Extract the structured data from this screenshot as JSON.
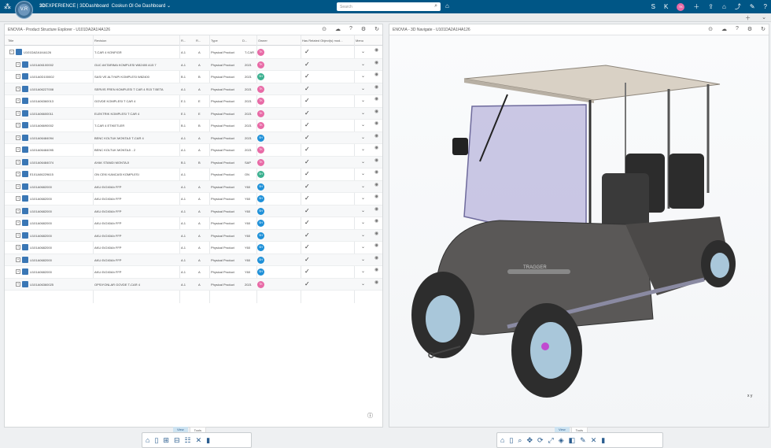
{
  "topbar": {
    "brand_prefix": "3D",
    "brand": "EXPERIENCE | 3DDashboard",
    "dashboard_name": "Coskun Ol Ge Dashboard",
    "search_placeholder": "Search",
    "compass_label": "V.R",
    "user_initials": "TK",
    "user_letters": [
      "S",
      "K"
    ]
  },
  "left_panel": {
    "title": "ENOVIA - Product Structure Explorer - U101DA2A1I4A126",
    "columns": [
      "Title",
      "Revision",
      "R...",
      "R...",
      "Type",
      "D...",
      "Owner",
      "Has Related Object(s) mod...",
      "Menu"
    ],
    "rows": [
      {
        "title": "U101DA2A1I4A126",
        "revision": "T-CAR 4 KONFIGR",
        "r1": "A.1",
        "r2": "A",
        "type": "Physical Product",
        "d": "T-CAR",
        "owner": "TK",
        "owner_color": "#e86aa6",
        "level": 0
      },
      {
        "title": "U101A06100002",
        "revision": "GUC AKTARIMA KOMPLESI W82400 A15 7",
        "r1": "A.1",
        "r2": "A",
        "type": "Physical Product",
        "d": "2021",
        "owner": "TK",
        "owner_color": "#e86aa6",
        "level": 1
      },
      {
        "title": "U101A0D100002",
        "revision": "SASI VE ALTYAPI KOMPLESI W82400",
        "r1": "B.1",
        "r2": "B",
        "type": "Physical Product",
        "d": "2021",
        "owner": "SH",
        "owner_color": "#3bb08f",
        "level": 1
      },
      {
        "title": "U101A06227008",
        "revision": "SERVIS FREN KOMPLESI T CAR 4 R15 T BETA",
        "r1": "A.1",
        "r2": "A",
        "type": "Physical Product",
        "d": "2021",
        "owner": "TK",
        "owner_color": "#e86aa6",
        "level": 1
      },
      {
        "title": "U101A06360013",
        "revision": "GOVDE KOMPLESI T CAR 4",
        "r1": "E.1",
        "r2": "E",
        "type": "Physical Product",
        "d": "2021",
        "owner": "TK",
        "owner_color": "#e86aa6",
        "level": 1
      },
      {
        "title": "U101A06600011",
        "revision": "ELEKTRIK KOMPLESI T CAR 4",
        "r1": "E.1",
        "r2": "E",
        "type": "Physical Product",
        "d": "2021",
        "owner": "TK",
        "owner_color": "#e86aa6",
        "level": 1
      },
      {
        "title": "U101A06690002",
        "revision": "T-CAR 4 ETIKETLER",
        "r1": "B.1",
        "r2": "B",
        "type": "Physical Product",
        "d": "2021",
        "owner": "TK",
        "owner_color": "#e86aa6",
        "level": 1
      },
      {
        "title": "U101A06484094",
        "revision": "BENC KOLTUK MONTAJI T-CAR 4",
        "r1": "A.1",
        "r2": "A",
        "type": "Physical Product",
        "d": "2021",
        "owner": "SH",
        "owner_color": "#1e90d8",
        "level": 1
      },
      {
        "title": "U101A06484095",
        "revision": "BENC KOLTUK MONTAJI - 2",
        "r1": "A.1",
        "r2": "A",
        "type": "Physical Product",
        "d": "2021",
        "owner": "TK",
        "owner_color": "#e86aa6",
        "level": 1
      },
      {
        "title": "U101A06484074",
        "revision": "AYAK STANDI MONTAJI",
        "r1": "B.1",
        "r2": "B",
        "type": "Physical Product",
        "d": "SAP",
        "owner": "TK",
        "owner_color": "#e86aa6",
        "level": 1
      },
      {
        "title": "E101A06229615",
        "revision": "ON CEKI KANCASI KOMPLESI",
        "r1": "A.1",
        "r2": "",
        "type": "Physical Product",
        "d": "ON",
        "owner": "SH",
        "owner_color": "#3bb08f",
        "level": 1
      },
      {
        "title": "U101A0682000",
        "revision": "AKU 6V240Ah FFP",
        "r1": "A.1",
        "r2": "A",
        "type": "Physical Product",
        "d": "Y60",
        "owner": "SH",
        "owner_color": "#1e90d8",
        "level": 1
      },
      {
        "title": "U101A0682000",
        "revision": "AKU 6V240Ah FFP",
        "r1": "A.1",
        "r2": "A",
        "type": "Physical Product",
        "d": "Y60",
        "owner": "SH",
        "owner_color": "#1e90d8",
        "level": 1
      },
      {
        "title": "U101A0682000",
        "revision": "AKU 6V240Ah FFP",
        "r1": "A.1",
        "r2": "A",
        "type": "Physical Product",
        "d": "Y60",
        "owner": "SH",
        "owner_color": "#1e90d8",
        "level": 1
      },
      {
        "title": "U101A0682000",
        "revision": "AKU 6V240Ah FFP",
        "r1": "A.1",
        "r2": "A",
        "type": "Physical Product",
        "d": "Y60",
        "owner": "SH",
        "owner_color": "#1e90d8",
        "level": 1
      },
      {
        "title": "U101A0682000",
        "revision": "AKU 6V240Ah FFP",
        "r1": "A.1",
        "r2": "A",
        "type": "Physical Product",
        "d": "Y60",
        "owner": "SH",
        "owner_color": "#1e90d8",
        "level": 1
      },
      {
        "title": "U101A0682000",
        "revision": "AKU 6V240Ah FFP",
        "r1": "A.1",
        "r2": "A",
        "type": "Physical Product",
        "d": "Y60",
        "owner": "SH",
        "owner_color": "#1e90d8",
        "level": 1
      },
      {
        "title": "U101A0682000",
        "revision": "AKU 6V240Ah FFP",
        "r1": "A.1",
        "r2": "A",
        "type": "Physical Product",
        "d": "Y60",
        "owner": "SH",
        "owner_color": "#1e90d8",
        "level": 1
      },
      {
        "title": "U101A0682000",
        "revision": "AKU 6V240Ah FFP",
        "r1": "A.1",
        "r2": "A",
        "type": "Physical Product",
        "d": "Y60",
        "owner": "SH",
        "owner_color": "#1e90d8",
        "level": 1
      },
      {
        "title": "U101A06360025",
        "revision": "OPSIYONLAR GOVDE T-CAR 4",
        "r1": "A.1",
        "r2": "A",
        "type": "Physical Product",
        "d": "2021",
        "owner": "TK",
        "owner_color": "#e86aa6",
        "level": 1
      }
    ],
    "view_tab": "View",
    "tools_tab": "Tools"
  },
  "right_panel": {
    "title": "ENOVIA - 3D Navigate - U101DA2A1I4A126",
    "view_tab": "View",
    "tools_tab": "Tools",
    "model_brand": "TRAGGER",
    "axis_label": "x  y"
  },
  "colors": {
    "topbar": "#005686",
    "accent": "#2a5d8f",
    "owner_tk": "#e86aa6",
    "owner_sh": "#1e90d8"
  }
}
